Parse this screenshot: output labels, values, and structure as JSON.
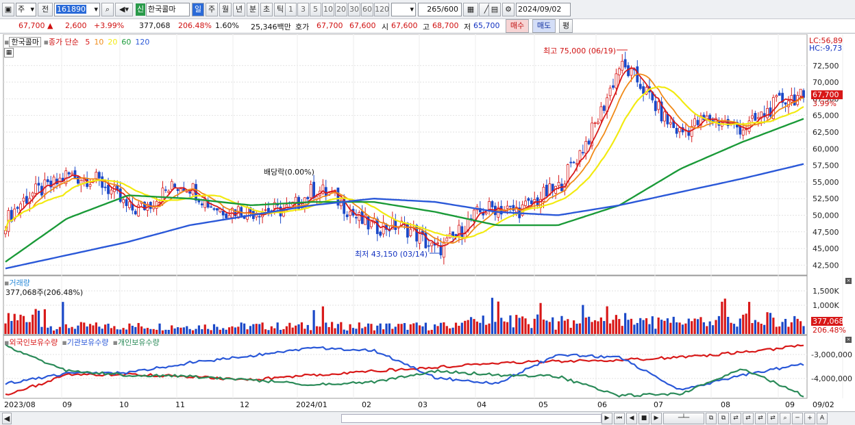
{
  "toolbar": {
    "type": "주",
    "prev": "전",
    "code": "161890",
    "name_badge": "신",
    "name": "한국콜마",
    "periods": [
      "일",
      "주",
      "월",
      "년",
      "분",
      "초",
      "틱"
    ],
    "active_period": "일",
    "minutes": [
      "1",
      "3",
      "5",
      "10",
      "20",
      "30",
      "60",
      "120"
    ],
    "count": "265",
    "count_total": "/600",
    "date": "2024/09/02"
  },
  "quote": {
    "price": "67,700",
    "arrow": "▲",
    "change": "2,600",
    "change_pct": "+3.99%",
    "volume": "377,068",
    "vol_ratio": "206.48%",
    "turnover": "1.60%",
    "amount": "25,346백만",
    "ask_label": "호가",
    "ask": "67,700",
    "bid": "67,600",
    "open_label": "시",
    "open": "67,600",
    "high_label": "고",
    "high": "68,700",
    "low_label": "저",
    "low": "65,700",
    "buy": "매수",
    "sell": "매도",
    "eval": "평"
  },
  "price_panel": {
    "stock": "한국콜마",
    "legend_label": "종가 단순",
    "ma": [
      "5",
      "10",
      "20",
      "60",
      "120"
    ],
    "ma_colors": [
      "#d81818",
      "#f08a18",
      "#f2ea10",
      "#1a9a38",
      "#2a58d8"
    ],
    "lc": "LC:56,89",
    "hc": "HC:-9,73",
    "y_ticks": [
      "72,500",
      "70,000",
      "67,500",
      "65,000",
      "62,500",
      "60,000",
      "57,500",
      "55,000",
      "52,500",
      "50,000",
      "47,500",
      "45,000",
      "42,500"
    ],
    "last_price": "67,700",
    "last_pct": "3.99%",
    "high_note": "최고 75,000 (06/19)",
    "low_note": "최저 43,150 (03/14)",
    "div_note": "배당락(0.00%)"
  },
  "volume_panel": {
    "title": "거래량",
    "summary": "377,068주(206.48%)",
    "y_ticks": [
      "1,500K",
      "1,000K"
    ],
    "last_vol": "377,068",
    "last_pct": "206.48%"
  },
  "holding_panel": {
    "series": [
      "외국인보유수량",
      "기관보유수량",
      "개인보유수량"
    ],
    "colors": [
      "#d81818",
      "#2a58d8",
      "#2a8a58"
    ],
    "y_ticks": [
      "-3,000,000",
      "-4,000,000"
    ]
  },
  "x_axis": [
    "2023/08",
    "09",
    "10",
    "11",
    "12",
    "2024/01",
    "02",
    "03",
    "04",
    "05",
    "06",
    "07",
    "08",
    "09"
  ],
  "x_right": "09/02",
  "chart_data": [
    {
      "type": "candlestick",
      "title": "한국콜마",
      "y_range": [
        41000,
        77000
      ],
      "series": [
        {
          "name": "종가",
          "months": [
            "2023/08",
            "09",
            "10",
            "11",
            "12",
            "2024/01",
            "02",
            "03",
            "04",
            "05",
            "06",
            "07",
            "08",
            "09/02"
          ],
          "values": [
            49000,
            57000,
            51500,
            54000,
            49500,
            53500,
            49000,
            45500,
            51000,
            53000,
            72000,
            63000,
            64000,
            67700
          ]
        },
        {
          "name": "60",
          "months": [
            "2023/08",
            "09",
            "10",
            "11",
            "12",
            "2024/01",
            "02",
            "03",
            "04",
            "05",
            "06",
            "07",
            "08",
            "09/02"
          ],
          "values": [
            43000,
            49500,
            53000,
            52500,
            51500,
            52000,
            52000,
            50500,
            48500,
            48500,
            51500,
            57000,
            61000,
            64500
          ]
        },
        {
          "name": "120",
          "months": [
            "2023/08",
            "09",
            "10",
            "11",
            "12",
            "2024/01",
            "02",
            "03",
            "04",
            "05",
            "06",
            "07",
            "08",
            "09/02"
          ],
          "values": [
            42000,
            44000,
            46000,
            48500,
            50000,
            51500,
            52500,
            52000,
            50500,
            50000,
            51500,
            53500,
            55500,
            57700
          ]
        }
      ],
      "annotations": [
        "최고 75,000 (06/19)",
        "최저 43,150 (03/14)",
        "배당락(0.00%)"
      ]
    },
    {
      "type": "bar",
      "title": "거래량",
      "y_ticks": [
        "1,000K",
        "1,500K"
      ],
      "last": "377,068"
    },
    {
      "type": "line",
      "series": [
        {
          "name": "외국인보유수량"
        },
        {
          "name": "기관보유수량"
        },
        {
          "name": "개인보유수량"
        }
      ],
      "y_ticks": [
        "-3,000,000",
        "-4,000,000"
      ]
    }
  ]
}
